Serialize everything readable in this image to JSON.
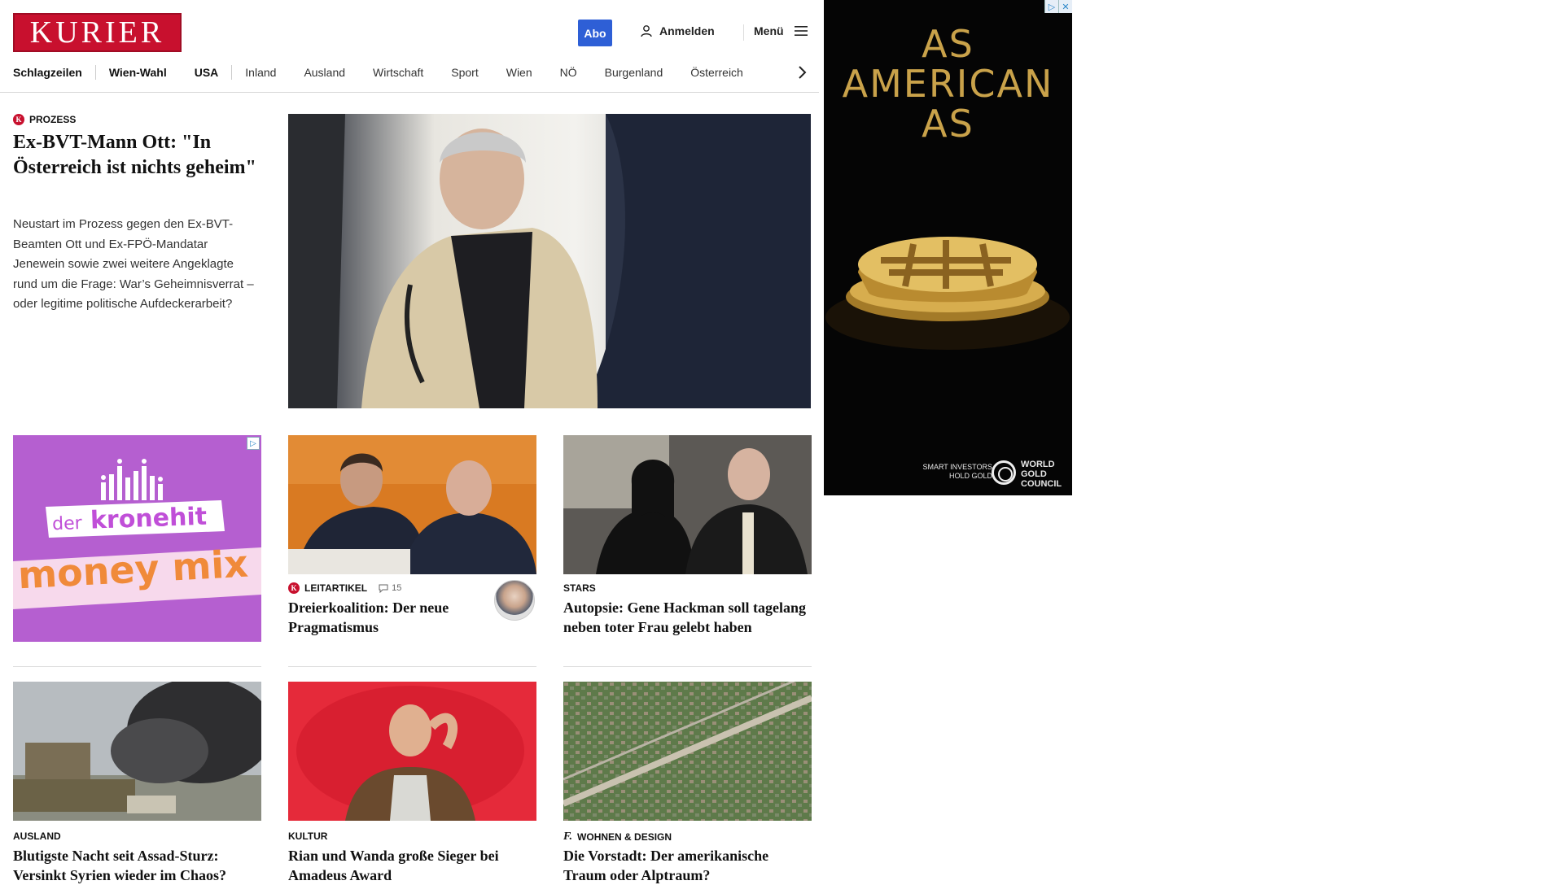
{
  "header": {
    "logo": "KURIER",
    "abo_label": "Abo",
    "login_label": "Anmelden",
    "menu_label": "Menü"
  },
  "nav": {
    "items": [
      "Schlagzeilen",
      "Wien-Wahl",
      "USA",
      "Inland",
      "Ausland",
      "Wirtschaft",
      "Sport",
      "Wien",
      "NÖ",
      "Burgenland",
      "Österreich"
    ]
  },
  "lead": {
    "kicker": "PROZESS",
    "title": "Ex-BVT-Mann Ott: \"In Österreich ist nichts geheim\"",
    "description": "Neustart im Prozess gegen den Ex-BVT-Beamten Ott und Ex-FPÖ-Mandatar Jenewein sowie zwei weitere Angeklagte rund um die Frage: War’s Geheimnisverrat – oder legitime politische Aufdeckerarbeit?"
  },
  "ad_kronehit": {
    "line1a": "der",
    "line1b": "kronehit",
    "line2": "money mix"
  },
  "cards": [
    {
      "kicker": "LEITARTIKEL",
      "comments": "15",
      "title": "Dreierkoalition: Der neue Pragmatismus"
    },
    {
      "kicker": "STARS",
      "title": "Autopsie: Gene Hackman soll tagelang neben toter Frau gelebt haben"
    },
    {
      "kicker": "AUSLAND",
      "title": "Blutigste Nacht seit Assad-Sturz: Versinkt Syrien wieder im Chaos?"
    },
    {
      "kicker": "KULTUR",
      "title": "Rian und Wanda große Sieger bei Amadeus Award"
    },
    {
      "kicker": "WOHNEN & DESIGN",
      "title": "Die Vorstadt: Der amerikanische Traum oder Alptraum?"
    }
  ],
  "ad_right": {
    "headline_1": "AS",
    "headline_2": "AMERICAN",
    "headline_3": "AS",
    "tagline_1": "SMART INVESTORS",
    "tagline_2": "HOLD GOLD",
    "brand_1": "WORLD",
    "brand_2": "GOLD",
    "brand_3": "COUNCIL"
  },
  "colors": {
    "brand_red": "#c8102e",
    "abo_blue": "#2e5fd6",
    "ad_purple": "#b55fd0",
    "gold": "#c9a24a"
  }
}
